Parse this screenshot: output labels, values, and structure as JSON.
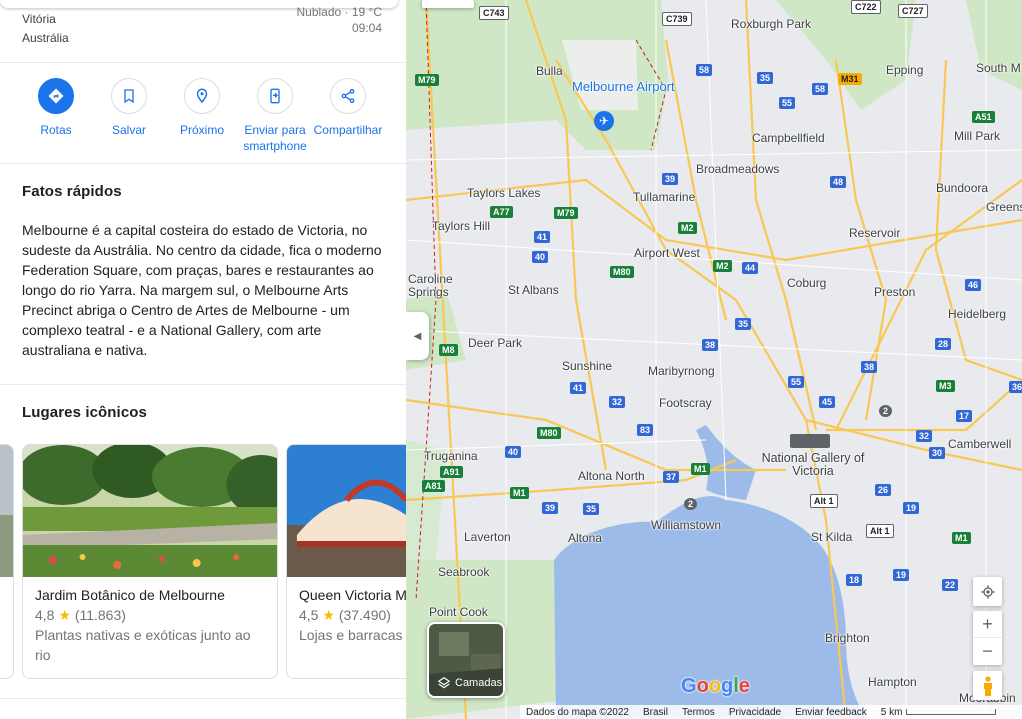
{
  "location": {
    "city": "Vitória",
    "country": "Austrália"
  },
  "weather": {
    "condition": "Nublado · 19 °C",
    "time": "09:04"
  },
  "actions": [
    {
      "label": "Rotas",
      "icon": "directions-icon"
    },
    {
      "label": "Salvar",
      "icon": "bookmark-icon"
    },
    {
      "label": "Próximo",
      "icon": "nearby-icon"
    },
    {
      "label": "Enviar para smartphone",
      "icon": "send-to-phone-icon"
    },
    {
      "label": "Compartilhar",
      "icon": "share-icon"
    }
  ],
  "quick_facts": {
    "title": "Fatos rápidos",
    "text": "Melbourne é a capital costeira do estado de Victoria, no sudeste da Austrália. No centro da cidade, fica o moderno Federation Square, com praças, bares e restaurantes ao longo do rio Yarra. Na margem sul, o Melbourne Arts Precinct abriga o Centro de Artes de Melbourne - um complexo teatral - e a National Gallery, com arte australiana e nativa."
  },
  "iconic_places": {
    "title": "Lugares icônicos",
    "cards": [
      {
        "name": "Jardim Botânico de Melbourne",
        "rating": "4,8",
        "reviews": "(11.863)",
        "description": "Plantas nativas e exóticas junto ao rio"
      },
      {
        "name": "Queen Victoria Market",
        "rating": "4,5",
        "reviews": "(37.490)",
        "description": "Lojas e barracas"
      }
    ]
  },
  "map": {
    "labels": {
      "roxburgh": "Roxburgh Park",
      "bulla": "Bulla",
      "airport": "Melbourne Airport",
      "epping": "Epping",
      "southm": "South M",
      "campbellfield": "Campbellfield",
      "millpark": "Mill Park",
      "broadmeadows": "Broadmeadows",
      "bundoora": "Bundoora",
      "greens": "Greens",
      "taylorslakes": "Taylors Lakes",
      "tullamarine": "Tullamarine",
      "taylorshill": "Taylors Hill",
      "reservoir": "Reservoir",
      "airportwest": "Airport West",
      "caroline": "Caroline Springs",
      "stalbans": "St Albans",
      "coburg": "Coburg",
      "preston": "Preston",
      "heidelberg": "Heidelberg",
      "deerpark": "Deer Park",
      "sunshine": "Sunshine",
      "maribyrnong": "Maribyrnong",
      "footscray": "Footscray",
      "truganina": "Truganina",
      "ngv": "National Gallery of Victoria",
      "camberwell": "Camberwell",
      "altonanorth": "Altona North",
      "williamstown": "Williamstown",
      "laverton": "Laverton",
      "altona": "Altona",
      "stkilda": "St Kilda",
      "seabrook": "Seabrook",
      "pointcook": "Point Cook",
      "brighton": "Brighton",
      "hampton": "Hampton",
      "moorabbin": "Moorabbin"
    },
    "layers_label": "Camadas",
    "google_logo": "Google",
    "footer": [
      "Dados do mapa ©2022",
      "Brasil",
      "Termos",
      "Privacidade",
      "Enviar feedback",
      "5 km"
    ],
    "shields": [
      "C743",
      "C739",
      "C722",
      "C727",
      "M79",
      "58",
      "35",
      "55",
      "58",
      "M31",
      "A51",
      "39",
      "48",
      "A77",
      "M79",
      "41",
      "M2",
      "44",
      "40",
      "M80",
      "M2",
      "35",
      "46",
      "38",
      "28",
      "M8",
      "41",
      "32",
      "55",
      "45",
      "38",
      "M3",
      "17",
      "32",
      "36",
      "2",
      "40",
      "83",
      "M80",
      "37",
      "M1",
      "A91",
      "A81",
      "39",
      "35",
      "M1",
      "2",
      "Alt 1",
      "Alt 1",
      "26",
      "19",
      "30",
      "M1",
      "19",
      "22",
      "18"
    ],
    "accent": "#1a73e8"
  }
}
